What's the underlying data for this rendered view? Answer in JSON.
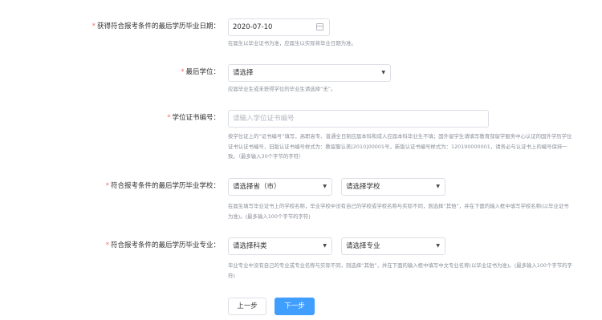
{
  "form": {
    "graduation_date": {
      "star": "*",
      "label": "获得符合报考条件的最后学历毕业日期：",
      "value": "2020-07-10",
      "hint": "在届生以毕业证书为准，应届生以实际将毕业日期为准。"
    },
    "degree": {
      "star": "*",
      "label": "最后学位：",
      "value": "请选择",
      "hint": "应届毕业生或未获得学位的毕业生请选择“无”。"
    },
    "degree_cert": {
      "star": "*",
      "label": "学位证书编号：",
      "placeholder": "请输入学位证书编号",
      "hint": "按学位证上的“证书编号”填写，高职高专、普通全日制应届本科和成人应届本科毕业生不填；国外留学生请填写教育部留学服务中心认证的国外学历学位证书认证书编号，旧版认证书编号样式为：教留服认美[2010]00001号，新版认证书编号样式为：120190000001，请务必与认证书上的编号保持一致。（最多输入30个字节的字符）"
    },
    "school": {
      "star": "*",
      "label": "符合报考条件的最后学历毕业学校：",
      "province": "请选择省（市）",
      "school": "请选择学校",
      "hint": "在届生填写毕业证书上的学校名称，毕业学校中没有自己的学校或学校名称与实际不同，则选择“其他”，并在下面的输入框中填写学校名称(以毕业证书为准)。(最多输入100个字节的字符)"
    },
    "major": {
      "star": "*",
      "label": "符合报考条件的最后学历毕业专业：",
      "category": "请选择科类",
      "major": "请选择专业",
      "hint": "毕业专业中没有自己的专业或专业名称与实际不同，则选择“其他”，并在下面的输入框中填写中文专业名称(以毕业证书为准)。(最多输入100个字节的字符)"
    }
  },
  "buttons": {
    "prev": "上一步",
    "next": "下一步"
  },
  "icons": {
    "calendar": "calendar-icon",
    "caret": "▼"
  },
  "colors": {
    "required": "#f56c6c",
    "primary": "#409eff"
  }
}
